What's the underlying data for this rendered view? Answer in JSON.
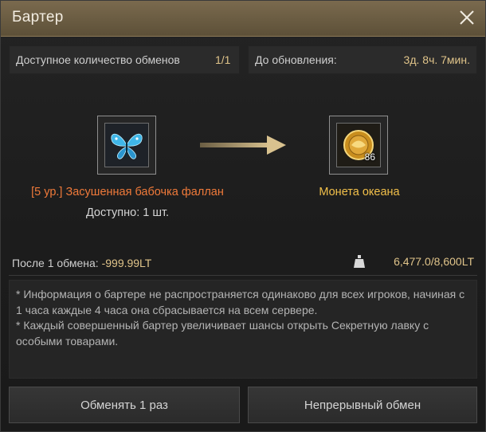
{
  "window": {
    "title": "Бартер"
  },
  "exchanges": {
    "label": "Доступное количество обменов",
    "value": "1/1"
  },
  "refresh": {
    "label": "До обновления:",
    "value": "3д. 8ч. 7мин."
  },
  "give_item": {
    "icon": "butterfly-icon",
    "name": "[5 ур.] Засушенная бабочка фаллан",
    "availability": "Доступно: 1 шт."
  },
  "receive_item": {
    "icon": "ocean-coin-icon",
    "name": "Монета океана",
    "quantity": "86"
  },
  "after": {
    "label": "После 1 обмена:",
    "value": "-999.99LT"
  },
  "weight": {
    "icon": "weight-icon",
    "value": "6,477.0/8,600LT"
  },
  "info": {
    "line1": "* Информация о бартере не распространяется одинаково для всех игроков, начиная с 1 часа каждые 4 часа она сбрасывается на всем сервере.",
    "line2": "* Каждый совершенный бартер увеличивает шансы открыть Секретную лавку с особыми товарами."
  },
  "buttons": {
    "exchange_once": "Обменять 1 раз",
    "continuous": "Непрерывный обмен"
  },
  "colors": {
    "accent_gold": "#e0c48a",
    "item_orange": "#f07a3a",
    "item_gold": "#f2c04a"
  }
}
